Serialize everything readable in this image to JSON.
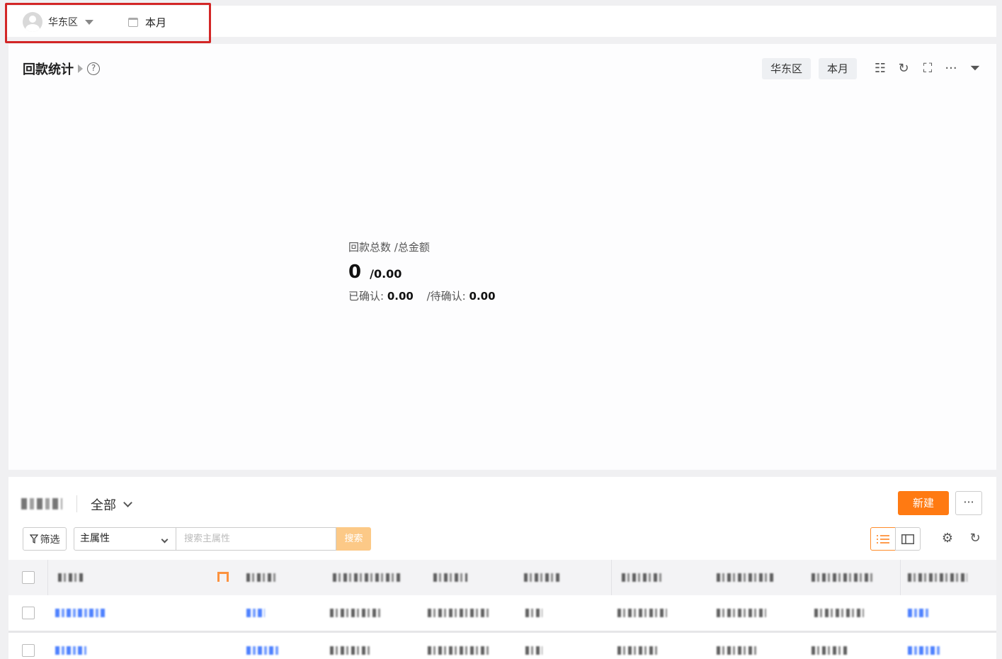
{
  "topbar": {
    "region": "华东区",
    "period": "本月"
  },
  "stats": {
    "title": "回款统计",
    "help": "?",
    "chip_region": "华东区",
    "chip_period": "本月",
    "summary_label": "回款总数  /总金额",
    "count": "0",
    "amount": "/0.00",
    "confirmed_label": "已确认: ",
    "confirmed_value": "0.00",
    "pending_label": "/待确认: ",
    "pending_value": "0.00",
    "tools": {
      "list": "☷",
      "refresh": "↻",
      "fullscreen": "⛶",
      "more": "···",
      "filter": "⏷"
    }
  },
  "list": {
    "scope": "全部",
    "new_label": "新建",
    "more_label": "···",
    "filter_label": "筛选",
    "attr_select": "主属性",
    "search_placeholder": "搜索主属性",
    "search_button": "搜索",
    "tools": {
      "settings": "⚙",
      "refresh": "↻"
    }
  },
  "colors": {
    "accent": "#ff7a12",
    "highlight_box": "#d32626",
    "link_blue": "#2f6bff"
  }
}
